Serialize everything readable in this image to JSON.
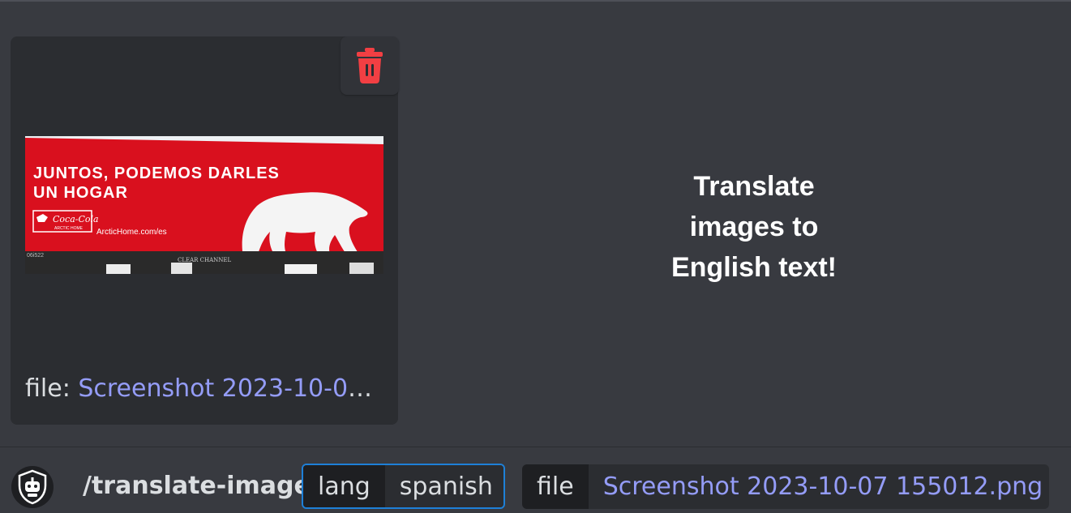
{
  "attachment": {
    "file_label": "file:",
    "file_name": "Screenshot 2023-10-07 155012.png",
    "image": {
      "headline_line1": "JUNTOS, PODEMOS DARLES",
      "headline_line2": "UN HOGAR",
      "brand": "Coca-Cola",
      "brand_sub": "ARCTIC HOME",
      "url": "ArcticHome.com/es",
      "panel_id": "06i522",
      "operator": "CLEAR CHANNEL"
    }
  },
  "promo": {
    "line1": "Translate",
    "line2": "images to",
    "line3": "English text!"
  },
  "command": {
    "name": "/translate-image",
    "options": [
      {
        "key": "lang",
        "value": "spanish"
      },
      {
        "key": "file",
        "value": "Screenshot 2023-10-07 155012.png"
      }
    ]
  },
  "icons": {
    "delete": "trash-icon",
    "bot": "robot-shield-icon"
  },
  "colors": {
    "background": "#383a40",
    "card": "#2b2d31",
    "danger": "#f23f43",
    "link": "#949cf7",
    "focus": "#1e80d8",
    "billboard_red": "#d9101e"
  }
}
